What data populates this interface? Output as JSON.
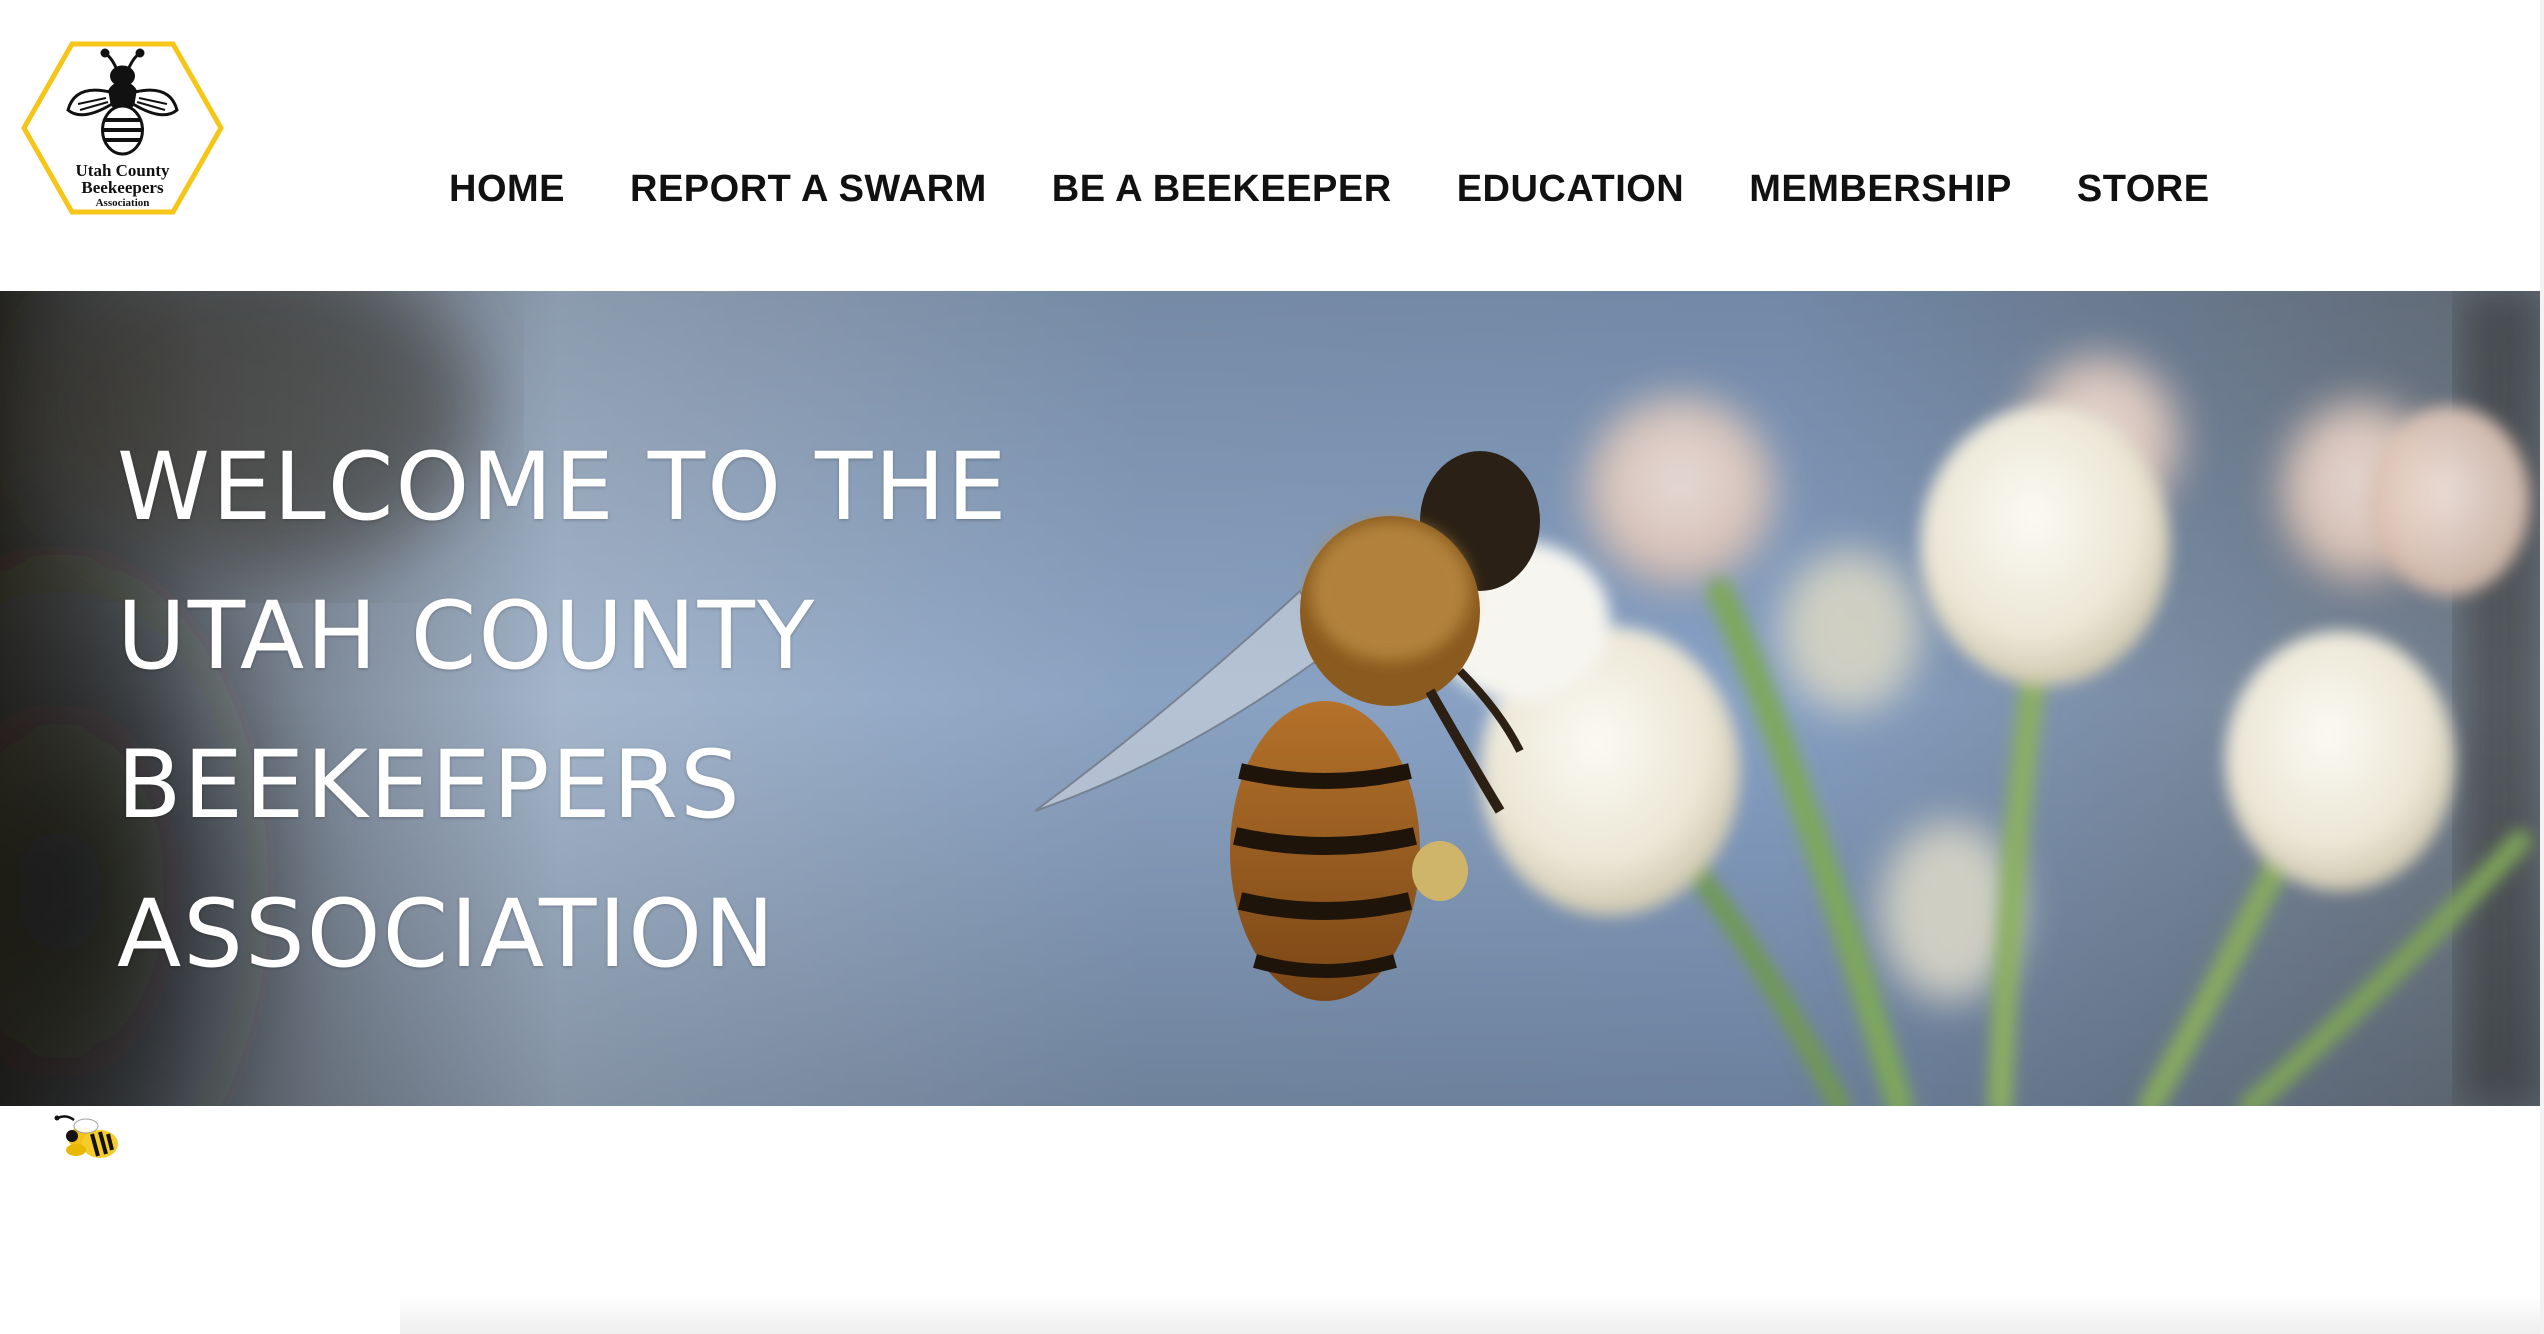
{
  "header": {
    "logo": {
      "icon": "bee-icon",
      "line1": "Utah County",
      "line2": "Beekeepers",
      "line3": "Association",
      "border_color": "#f5c518"
    },
    "nav": [
      {
        "label": "HOME"
      },
      {
        "label": "REPORT A SWARM"
      },
      {
        "label": "BE A BEEKEEPER"
      },
      {
        "label": "EDUCATION"
      },
      {
        "label": "MEMBERSHIP"
      },
      {
        "label": "STORE"
      }
    ]
  },
  "hero": {
    "title_lines": [
      "WELCOME TO THE",
      "UTAH COUNTY",
      "BEEKEEPERS",
      "ASSOCIATION"
    ],
    "image": "honeybee-on-white-blossom-photo",
    "text_color": "#ffffff"
  },
  "footer_icon": "bee-icon"
}
